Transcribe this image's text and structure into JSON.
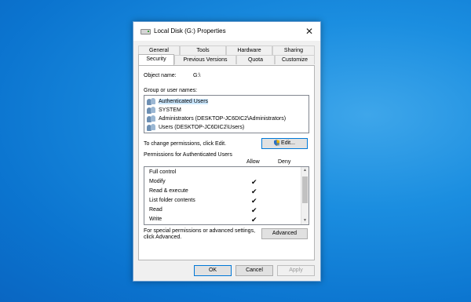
{
  "window": {
    "title": "Local Disk (G:) Properties",
    "close_glyph": "✕"
  },
  "tabs": {
    "row1": [
      "General",
      "Tools",
      "Hardware",
      "Sharing"
    ],
    "row2": [
      "Security",
      "Previous Versions",
      "Quota",
      "Customize"
    ],
    "active": "Security"
  },
  "object": {
    "label": "Object name:",
    "value": "G:\\"
  },
  "groups": {
    "label": "Group or user names:",
    "items": [
      {
        "icon": "user-group-icon",
        "name": "Authenticated Users",
        "selected": true
      },
      {
        "icon": "user-group-icon",
        "name": "SYSTEM"
      },
      {
        "icon": "user-group-icon",
        "name": "Administrators (DESKTOP-JC6DIC2\\Administrators)"
      },
      {
        "icon": "user-group-icon",
        "name": "Users (DESKTOP-JC6DIC2\\Users)"
      }
    ]
  },
  "change_text": "To change permissions, click Edit.",
  "edit_button": {
    "label": "Edit...",
    "icon": "shield-icon"
  },
  "permissions": {
    "header": "Permissions for Authenticated Users",
    "allow_label": "Allow",
    "deny_label": "Deny",
    "rows": [
      {
        "name": "Full control",
        "allow": ""
      },
      {
        "name": "Modify",
        "allow": "✔"
      },
      {
        "name": "Read & execute",
        "allow": "✔"
      },
      {
        "name": "List folder contents",
        "allow": "✔"
      },
      {
        "name": "Read",
        "allow": "✔"
      },
      {
        "name": "Write",
        "allow": "✔"
      }
    ]
  },
  "special": {
    "text1": "For special permissions or advanced settings,",
    "text2": "click Advanced."
  },
  "advanced_button": "Advanced",
  "footer": {
    "ok": "OK",
    "cancel": "Cancel",
    "apply": "Apply"
  },
  "colors": {
    "desktop": "#0b74cf",
    "selection": "#cce8ff",
    "default_border": "#0078d7"
  }
}
